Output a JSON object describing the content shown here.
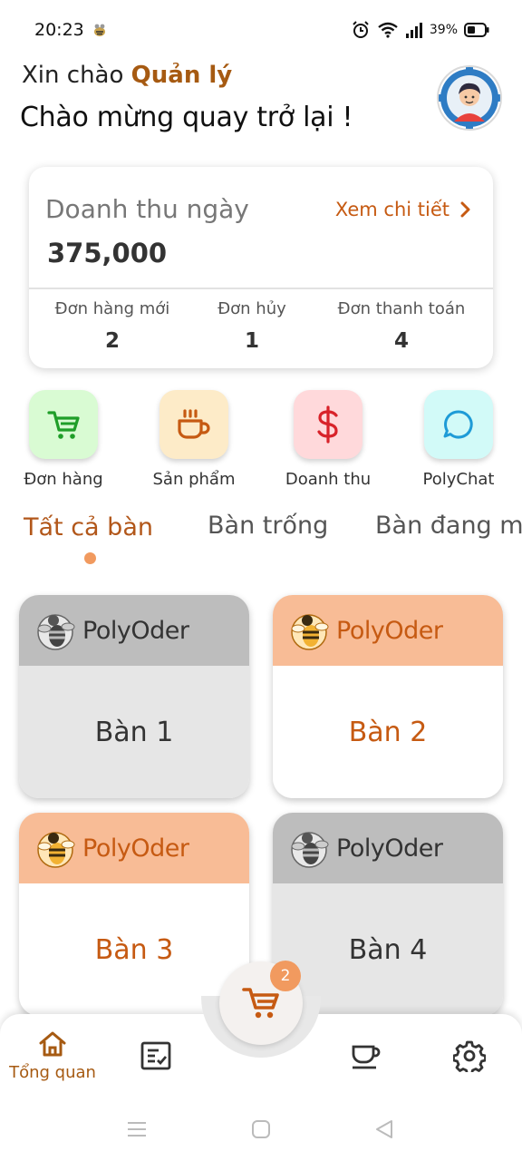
{
  "status_bar": {
    "time": "20:23",
    "battery": "39%"
  },
  "header": {
    "greeting_prefix": "Xin chào",
    "greeting_name": "Quản lý",
    "welcome": "Chào mừng quay trở lại !"
  },
  "revenue_card": {
    "title": "Doanh thu ngày",
    "detail_link": "Xem chi tiết",
    "value": "375,000",
    "stats": [
      {
        "label": "Đơn hàng mới",
        "value": "2"
      },
      {
        "label": "Đơn hủy",
        "value": "1"
      },
      {
        "label": "Đơn thanh toán",
        "value": "4"
      }
    ]
  },
  "quick_actions": [
    {
      "label": "Đơn hàng",
      "icon": "cart-icon",
      "bg": "#D9FBD3",
      "color": "#1F9E28"
    },
    {
      "label": "Sản phẩm",
      "icon": "coffee-icon",
      "bg": "#FDEBC8",
      "color": "#C65A12"
    },
    {
      "label": "Doanh thu",
      "icon": "dollar-icon",
      "bg": "#FFD9DB",
      "color": "#D8232A"
    },
    {
      "label": "PolyChat",
      "icon": "chat-icon",
      "bg": "#D2FAF8",
      "color": "#1E9BD7"
    }
  ],
  "tabs": [
    "Tất cả bàn",
    "Bàn trống",
    "Bàn đang m"
  ],
  "tables": [
    {
      "name": "Bàn 1",
      "brand": "PolyOder",
      "status": "busy"
    },
    {
      "name": "Bàn 2",
      "brand": "PolyOder",
      "status": "free"
    },
    {
      "name": "Bàn 3",
      "brand": "PolyOder",
      "status": "free"
    },
    {
      "name": "Bàn 4",
      "brand": "PolyOder",
      "status": "busy"
    }
  ],
  "cart": {
    "badge": "2"
  },
  "bottom_nav": {
    "home_label": "Tổng quan"
  },
  "colors": {
    "accent": "#C65A12",
    "accent_light": "#F19A5F",
    "header_free": "#F8BC96",
    "header_busy": "#BDBDBD"
  }
}
